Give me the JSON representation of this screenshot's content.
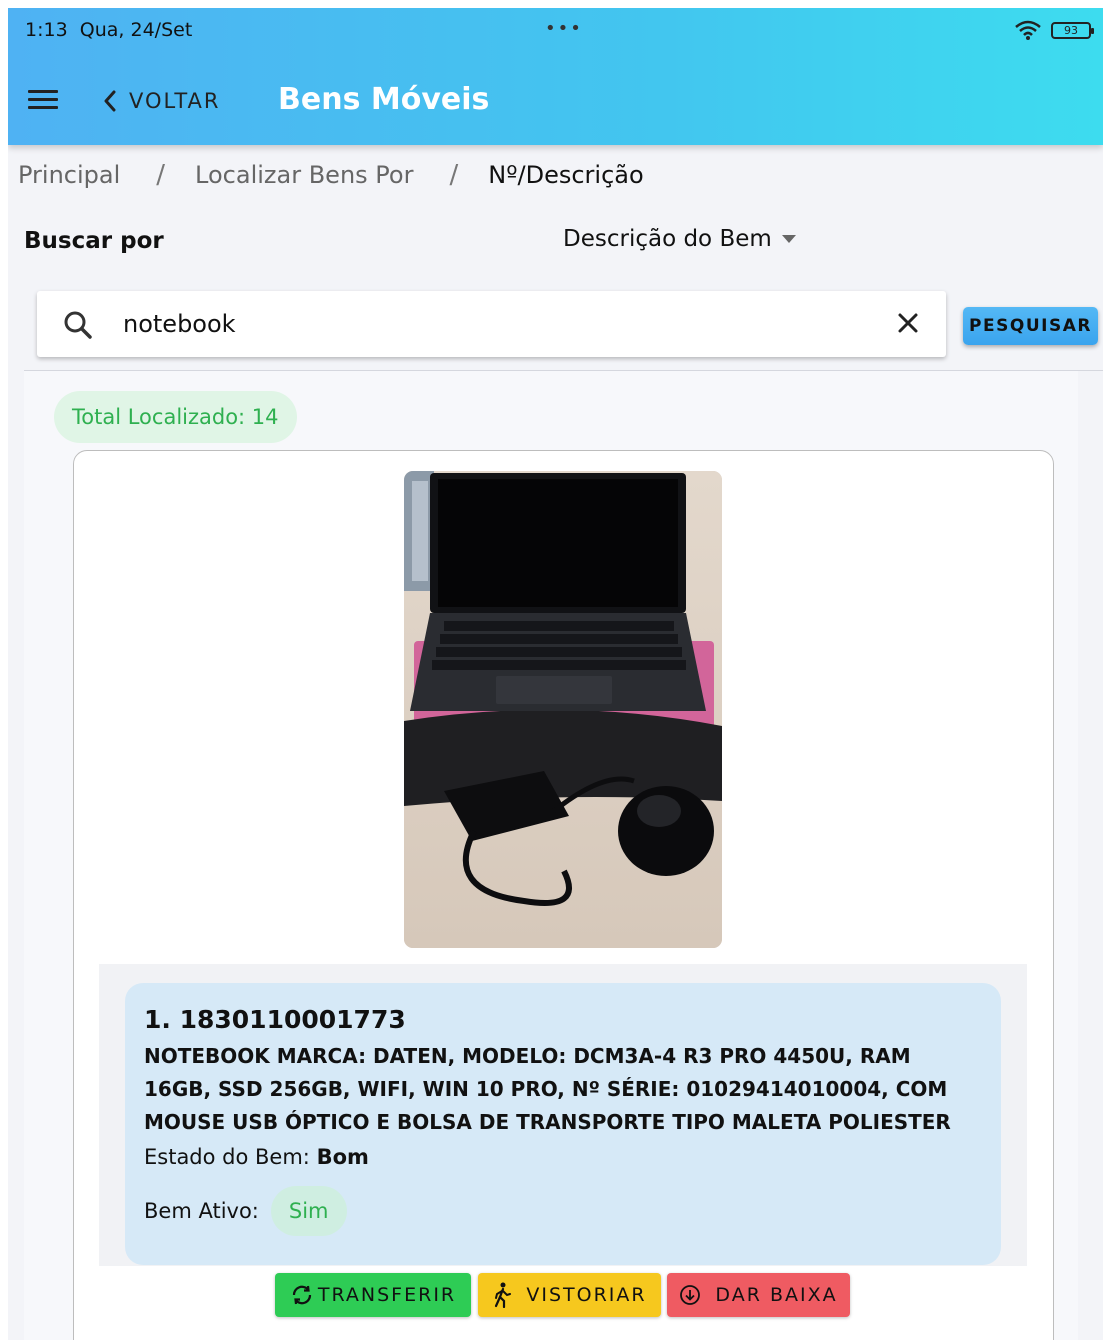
{
  "status_bar": {
    "time": "1:13",
    "date": "Qua, 24/Set",
    "dots": "•••",
    "battery": "93"
  },
  "header": {
    "back_label": "VOLTAR",
    "title": "Bens Móveis"
  },
  "breadcrumb": {
    "items": [
      "Principal",
      "Localizar Bens Por",
      "Nº/Descrição"
    ],
    "separator": "/"
  },
  "search": {
    "by_label": "Buscar por",
    "by_value": "Descrição do Bem",
    "query": "notebook",
    "button_label": "PESQUISAR"
  },
  "results": {
    "total_label": "Total Localizado: 14",
    "items": [
      {
        "number": "1. 1830110001773",
        "description": "NOTEBOOK MARCA: DATEN, MODELO: DCM3A-4 R3 PRO 4450U, RAM 16GB, SSD 256GB, WIFI, WIN 10 PRO, Nº SÉRIE: 01029414010004, COM MOUSE USB ÓPTICO E BOLSA DE TRANSPORTE TIPO MALETA POLIESTER",
        "state_label": "Estado do Bem:",
        "state_value": "Bom",
        "active_label": "Bem Ativo:",
        "active_value": "Sim"
      }
    ]
  },
  "actions": {
    "transfer": "TRANSFERIR",
    "inspect": "VISTORIAR",
    "discharge": "DAR BAIXA"
  },
  "colors": {
    "header_gradient_start": "#4fb2f3",
    "header_gradient_end": "#3ddcef",
    "success_green": "#2fb050",
    "transfer_button": "#2ecc55",
    "inspect_button": "#f6c81e",
    "discharge_button": "#ef5b62",
    "info_panel": "#d6e9f7"
  },
  "icons": [
    "menu-icon",
    "chevron-left-icon",
    "search-icon",
    "close-icon",
    "refresh-icon",
    "walking-person-icon",
    "download-circle-icon",
    "wifi-icon",
    "battery-icon",
    "caret-down-icon"
  ]
}
